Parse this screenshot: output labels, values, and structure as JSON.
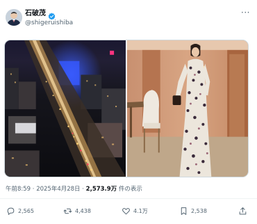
{
  "author": {
    "display_name": "石破茂",
    "handle": "@shigeruishiba",
    "verified_color": "#1d9bf0"
  },
  "header": {
    "more_label": "···"
  },
  "media": {
    "images": [
      {
        "name": "night-city-aerial-photo"
      },
      {
        "name": "woman-in-floral-dress-photo"
      }
    ]
  },
  "meta": {
    "time": "午前8:59",
    "separator": "·",
    "date": "2025年4月28日",
    "views": "2,573.9万",
    "views_suffix": "件の表示"
  },
  "actions": {
    "replies": "2,565",
    "reposts": "4,438",
    "likes": "4.1万",
    "bookmarks": "2,538"
  },
  "colors": {
    "text": "#0f1419",
    "secondary": "#536471",
    "border": "#cfd9de"
  }
}
